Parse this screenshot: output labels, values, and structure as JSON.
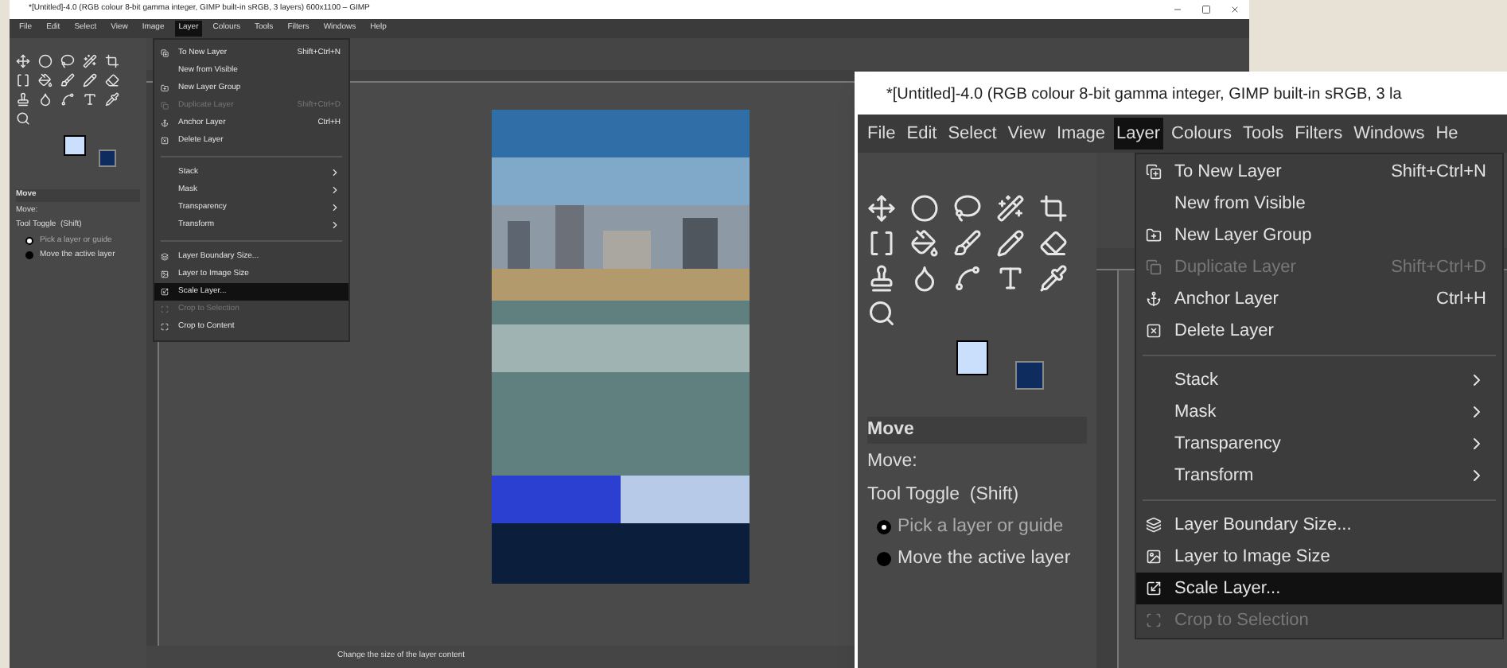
{
  "windows": [
    {
      "title": "*[Untitled]-4.0 (RGB colour 8-bit gamma integer, GIMP built-in sRGB, 3 layers) 600x1100 – GIMP",
      "menubar": [
        {
          "label": "File",
          "selected": false
        },
        {
          "label": "Edit",
          "selected": false
        },
        {
          "label": "Select",
          "selected": false
        },
        {
          "label": "View",
          "selected": false
        },
        {
          "label": "Image",
          "selected": false
        },
        {
          "label": "Layer",
          "selected": true
        },
        {
          "label": "Colours",
          "selected": false
        },
        {
          "label": "Tools",
          "selected": false
        },
        {
          "label": "Filters",
          "selected": false
        },
        {
          "label": "Windows",
          "selected": false
        },
        {
          "label": "Help",
          "selected": false
        }
      ],
      "layer_menu": [
        {
          "kind": "item",
          "label": "To New Layer",
          "shortcut": "Shift+Ctrl+N",
          "disabled": false,
          "highlighted": false
        },
        {
          "kind": "item",
          "label": "New from Visible",
          "disabled": false,
          "highlighted": false
        },
        {
          "kind": "item",
          "label": "New Layer Group",
          "disabled": false,
          "highlighted": false
        },
        {
          "kind": "item",
          "label": "Duplicate Layer",
          "shortcut": "Shift+Ctrl+D",
          "disabled": true,
          "highlighted": false
        },
        {
          "kind": "item",
          "label": "Anchor Layer",
          "shortcut": "Ctrl+H",
          "disabled": false,
          "highlighted": false
        },
        {
          "kind": "item",
          "label": "Delete Layer",
          "disabled": false,
          "highlighted": false
        },
        {
          "kind": "separator"
        },
        {
          "kind": "submenu",
          "label": "Stack",
          "disabled": false,
          "highlighted": false
        },
        {
          "kind": "submenu",
          "label": "Mask",
          "disabled": false,
          "highlighted": false
        },
        {
          "kind": "submenu",
          "label": "Transparency",
          "disabled": false,
          "highlighted": false
        },
        {
          "kind": "submenu",
          "label": "Transform",
          "disabled": false,
          "highlighted": false
        },
        {
          "kind": "separator"
        },
        {
          "kind": "item",
          "label": "Layer Boundary Size...",
          "disabled": false,
          "highlighted": false
        },
        {
          "kind": "item",
          "label": "Layer to Image Size",
          "disabled": false,
          "highlighted": false
        },
        {
          "kind": "item",
          "label": "Scale Layer...",
          "disabled": false,
          "highlighted": true
        },
        {
          "kind": "item",
          "label": "Crop to Selection",
          "disabled": true,
          "highlighted": false
        },
        {
          "kind": "item",
          "label": "Crop to Content",
          "disabled": false,
          "highlighted": false
        }
      ],
      "tool_options": {
        "title": "Move",
        "move_label": "Move:",
        "toggle_label": "Tool Toggle  (Shift)",
        "options": [
          {
            "label": "Pick a layer or guide",
            "selected": true
          },
          {
            "label": "Move the active layer",
            "selected": false
          }
        ]
      },
      "status": "Change the size of the layer content"
    },
    {
      "title": "*[Untitled]-4.0 (RGB colour 8-bit gamma integer, GIMP built-in sRGB, 3 la",
      "menubar": [
        {
          "label": "File",
          "selected": false
        },
        {
          "label": "Edit",
          "selected": false
        },
        {
          "label": "Select",
          "selected": false
        },
        {
          "label": "View",
          "selected": false
        },
        {
          "label": "Image",
          "selected": false
        },
        {
          "label": "Layer",
          "selected": true
        },
        {
          "label": "Colours",
          "selected": false
        },
        {
          "label": "Tools",
          "selected": false
        },
        {
          "label": "Filters",
          "selected": false
        },
        {
          "label": "Windows",
          "selected": false
        },
        {
          "label": "He",
          "selected": false
        }
      ],
      "layer_menu": [
        {
          "kind": "item",
          "label": "To New Layer",
          "shortcut": "Shift+Ctrl+N",
          "disabled": false,
          "highlighted": false
        },
        {
          "kind": "item",
          "label": "New from Visible",
          "disabled": false,
          "highlighted": false
        },
        {
          "kind": "item",
          "label": "New Layer Group",
          "disabled": false,
          "highlighted": false
        },
        {
          "kind": "item",
          "label": "Duplicate Layer",
          "shortcut": "Shift+Ctrl+D",
          "disabled": true,
          "highlighted": false
        },
        {
          "kind": "item",
          "label": "Anchor Layer",
          "shortcut": "Ctrl+H",
          "disabled": false,
          "highlighted": false
        },
        {
          "kind": "item",
          "label": "Delete Layer",
          "disabled": false,
          "highlighted": false
        },
        {
          "kind": "separator"
        },
        {
          "kind": "submenu",
          "label": "Stack",
          "disabled": false,
          "highlighted": false
        },
        {
          "kind": "submenu",
          "label": "Mask",
          "disabled": false,
          "highlighted": false
        },
        {
          "kind": "submenu",
          "label": "Transparency",
          "disabled": false,
          "highlighted": false
        },
        {
          "kind": "submenu",
          "label": "Transform",
          "disabled": false,
          "highlighted": false
        },
        {
          "kind": "separator"
        },
        {
          "kind": "item",
          "label": "Layer Boundary Size...",
          "disabled": false,
          "highlighted": false
        },
        {
          "kind": "item",
          "label": "Layer to Image Size",
          "disabled": false,
          "highlighted": false
        },
        {
          "kind": "item",
          "label": "Scale Layer...",
          "disabled": false,
          "highlighted": true
        },
        {
          "kind": "item",
          "label": "Crop to Selection",
          "disabled": true,
          "highlighted": false
        }
      ],
      "tool_options": {
        "title": "Move",
        "move_label": "Move:",
        "toggle_label": "Tool Toggle  (Shift)",
        "options": [
          {
            "label": "Pick a layer or guide",
            "selected": true
          },
          {
            "label": "Move the active layer",
            "selected": false
          }
        ]
      }
    }
  ]
}
